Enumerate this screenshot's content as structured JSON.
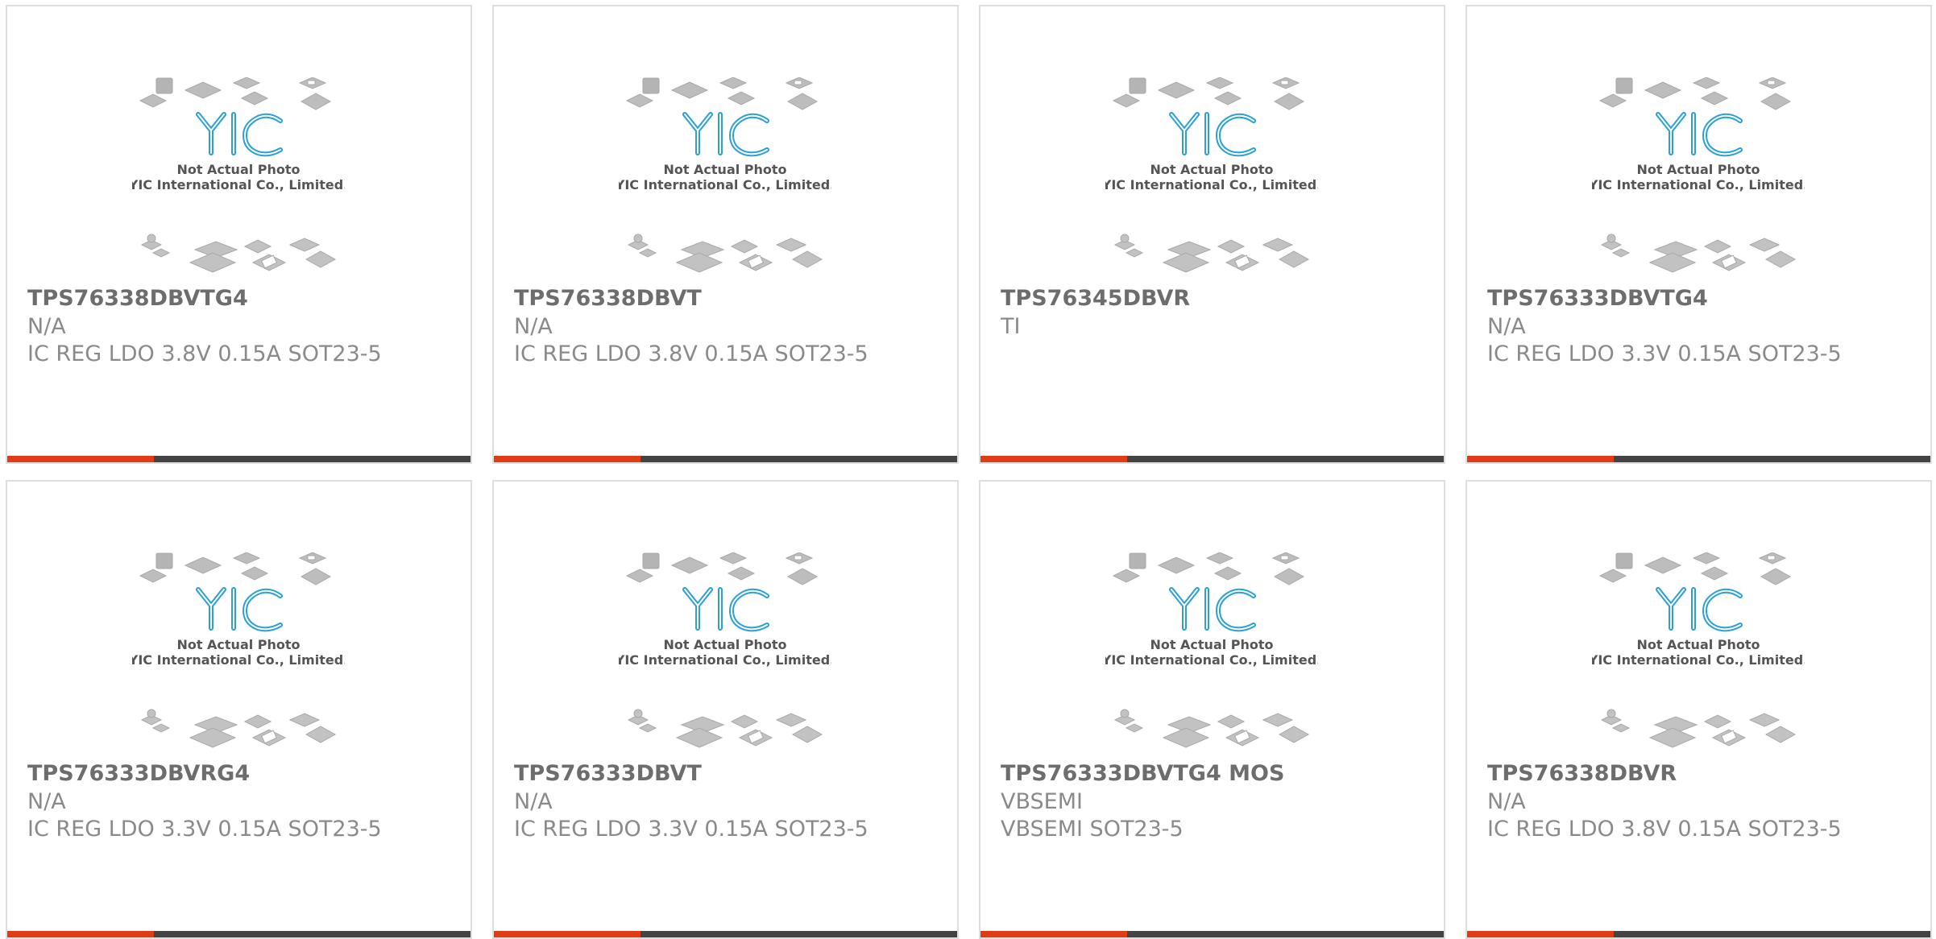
{
  "accent_color": "#e23c14",
  "bar_color": "#444444",
  "logo": {
    "brand_text": "YIC",
    "caption_line1": "Not Actual Photo",
    "caption_line2": "YIC International Co., Limited."
  },
  "products": [
    {
      "part_number": "TPS76338DBVTG4",
      "manufacturer": "N/A",
      "description": "IC REG LDO 3.8V 0.15A SOT23-5"
    },
    {
      "part_number": "TPS76338DBVT",
      "manufacturer": "N/A",
      "description": "IC REG LDO 3.8V 0.15A SOT23-5"
    },
    {
      "part_number": "TPS76345DBVR",
      "manufacturer": "TI",
      "description": ""
    },
    {
      "part_number": "TPS76333DBVTG4",
      "manufacturer": "N/A",
      "description": "IC REG LDO 3.3V 0.15A SOT23-5"
    },
    {
      "part_number": "TPS76333DBVRG4",
      "manufacturer": "N/A",
      "description": "IC REG LDO 3.3V 0.15A SOT23-5"
    },
    {
      "part_number": "TPS76333DBVT",
      "manufacturer": "N/A",
      "description": "IC REG LDO 3.3V 0.15A SOT23-5"
    },
    {
      "part_number": "TPS76333DBVTG4 MOS",
      "manufacturer": "VBSEMI",
      "description": "VBSEMI SOT23-5"
    },
    {
      "part_number": "TPS76338DBVR",
      "manufacturer": "N/A",
      "description": "IC REG LDO 3.8V 0.15A SOT23-5"
    }
  ]
}
